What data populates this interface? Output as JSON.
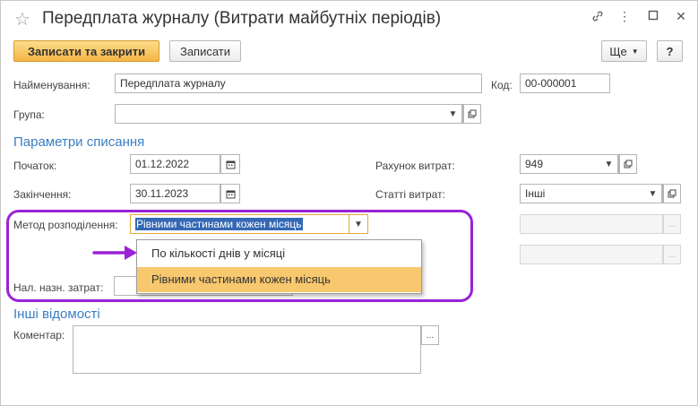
{
  "window": {
    "title": "Передплата журналу (Витрати майбутніх періодів)"
  },
  "toolbar": {
    "save_close_label": "Записати та закрити",
    "save_label": "Записати",
    "more_label": "Ще",
    "help_label": "?"
  },
  "form": {
    "name_label": "Найменування:",
    "name_value": "Передплата журналу",
    "code_label": "Код:",
    "code_value": "00-000001",
    "group_label": "Група:",
    "group_value": "",
    "writeoff_section": "Параметри списання",
    "start_label": "Початок:",
    "start_value": "01.12.2022",
    "end_label": "Закінчення:",
    "end_value": "30.11.2023",
    "account_label": "Рахунок витрат:",
    "account_value": "949",
    "cost_items_label": "Статті витрат:",
    "cost_items_value": "Інші",
    "method_label": "Метод розподілення:",
    "method_value": "Рівними частинами кожен місяць",
    "tax_label": "Нал. назн. затрат:",
    "other_section": "Інші відомості",
    "comment_label": "Коментар:",
    "ellipsis": "..."
  },
  "dropdown": {
    "options": [
      "По кількості днів у місяці",
      "Рівними частинами кожен місяць"
    ],
    "selected_index": 1
  },
  "annotation": {
    "highlight_color": "#9b22d6"
  },
  "colors": {
    "accent_blue": "#3a7ec3",
    "primary_button": "#f5b545",
    "dropdown_highlight": "#f8c86e"
  }
}
